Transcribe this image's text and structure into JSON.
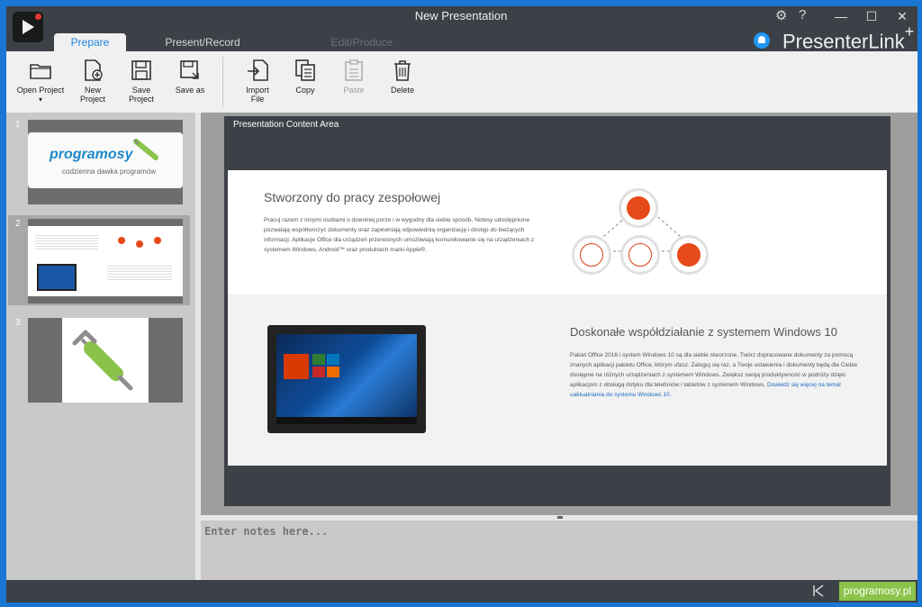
{
  "window": {
    "title": "New Presentation",
    "controls": {
      "minimize": "—",
      "maximize": "☐",
      "close": "✕"
    }
  },
  "header": {
    "gear_icon": "⚙",
    "help_icon": "?",
    "tabs": [
      {
        "label": "Prepare",
        "state": "active"
      },
      {
        "label": "Present/Record",
        "state": "normal"
      },
      {
        "label": "Edit/Produce",
        "state": "disabled"
      }
    ],
    "brand": "PresenterLink",
    "brand_sup": "+"
  },
  "ribbon": {
    "buttons": [
      {
        "label": "Open Project",
        "icon": "folder-icon",
        "dropdown": "▾"
      },
      {
        "label": "New\nProject",
        "icon": "new-file-icon"
      },
      {
        "label": "Save\nProject",
        "icon": "save-icon"
      },
      {
        "label": "Save as",
        "icon": "save-as-icon"
      },
      {
        "label": "Import\nFile",
        "icon": "import-icon"
      },
      {
        "label": "Copy",
        "icon": "copy-icon"
      },
      {
        "label": "Paste",
        "icon": "paste-icon",
        "disabled": true
      },
      {
        "label": "Delete",
        "icon": "trash-icon"
      }
    ]
  },
  "slides": [
    {
      "number": "1",
      "thumb": {
        "title": "programosy",
        "subtitle": "codzienna dawka programów"
      }
    },
    {
      "number": "2",
      "selected": true
    },
    {
      "number": "3"
    }
  ],
  "content_area": {
    "title": "Presentation Content Area",
    "slide": {
      "heading1": "Stworzony do pracy zespołowej",
      "para1": "Pracuj razem z innymi osobami o dowolnej porze i w wygodny dla siebie sposób. Notesy udostępnione pozwalają współtworzyć dokumenty oraz zapewniają odpowiednią organizację i dostęp do bieżących informacji. Aplikacje Office dla urządzeń przenośnych umożliwiają komunikowanie się na urządzeniach z systemem Windows, Android™ oraz produktach marki Apple®.",
      "heading2": "Doskonałe współdziałanie z systemem Windows 10",
      "para2": "Pakiet Office 2016 i system Windows 10 są dla siebie stworzone. Twórz dopracowane dokumenty za pomocą znanych aplikacji pakietu Office, którym ufasz. Zaloguj się raz, a Twoje ustawienia i dokumenty będą dla Ciebie dostępne na różnych urządzeniach z systemem Windows. Zwiększ swoją produktywność w podróży dzięki aplikacjom z obsługą dotyku dla telefonów i tabletów z systemem Windows.",
      "para2_link": "Dowiedz się więcej na temat uaktualniania do systemu Windows 10."
    }
  },
  "notes": {
    "placeholder": "Enter notes here..."
  },
  "status": {
    "badge": "programosy.pl"
  },
  "colors": {
    "accent": "#1e88e5",
    "title_bg": "#3c4147",
    "brand_green": "#8bc34a",
    "diagram_orange": "#e64a19"
  }
}
